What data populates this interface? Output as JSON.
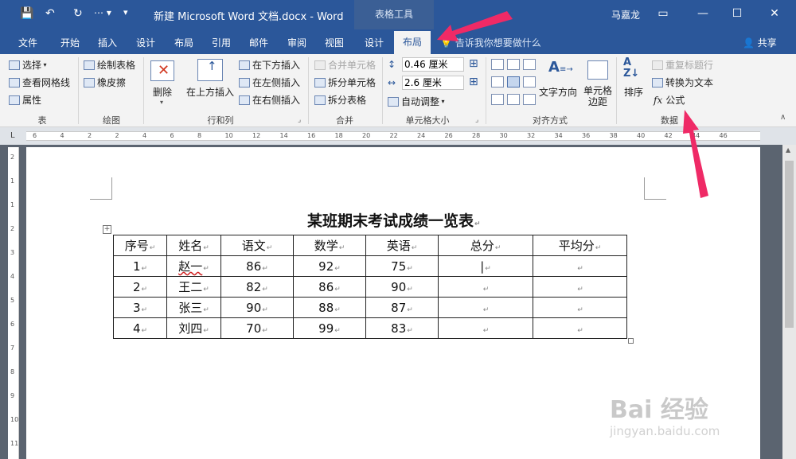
{
  "titlebar": {
    "title": "新建 Microsoft Word 文档.docx  -  Word",
    "context_title": "表格工具",
    "user": "马嘉龙",
    "qat": {
      "save": "💾",
      "undo": "↶",
      "redo": "↻"
    }
  },
  "tabs": [
    "文件",
    "开始",
    "插入",
    "设计",
    "布局",
    "引用",
    "邮件",
    "审阅",
    "视图",
    "设计"
  ],
  "active_tab": "布局",
  "tell_me": "告诉我你想要做什么",
  "share": "共享",
  "ribbon": {
    "table": {
      "select": "选择",
      "gridlines": "查看网格线",
      "properties": "属性",
      "label": "表"
    },
    "draw": {
      "draw_table": "绘制表格",
      "eraser": "橡皮擦",
      "label": "绘图"
    },
    "rows_cols": {
      "delete": "删除",
      "insert_above": "在上方插入",
      "insert_below": "在下方插入",
      "insert_left": "在左侧插入",
      "insert_right": "在右侧插入",
      "label": "行和列"
    },
    "merge": {
      "merge_cells": "合并单元格",
      "split_cells": "拆分单元格",
      "split_table": "拆分表格",
      "label": "合并"
    },
    "cell_size": {
      "height": "0.46 厘米",
      "width": "2.6 厘米",
      "autofit": "自动调整",
      "label": "单元格大小"
    },
    "alignment": {
      "text_direction": "文字方向",
      "cell_margins": "单元格边距",
      "label": "对齐方式"
    },
    "data": {
      "sort": "排序",
      "repeat_header": "重复标题行",
      "convert_text": "转换为文本",
      "formula": "公式",
      "label": "数据"
    }
  },
  "ruler_ticks": [
    "6",
    "4",
    "2",
    "2",
    "4",
    "6",
    "8",
    "10",
    "12",
    "14",
    "16",
    "18",
    "20",
    "22",
    "24",
    "26",
    "28",
    "30",
    "32",
    "34",
    "36",
    "38",
    "40",
    "42",
    "44",
    "46"
  ],
  "document": {
    "heading": "某班期末考试成绩一览表",
    "headers": [
      "序号",
      "姓名",
      "语文",
      "数学",
      "英语",
      "总分",
      "平均分"
    ],
    "rows": [
      [
        "1",
        "赵一",
        "86",
        "92",
        "75",
        "",
        ""
      ],
      [
        "2",
        "王二",
        "82",
        "86",
        "90",
        "",
        ""
      ],
      [
        "3",
        "张三",
        "90",
        "88",
        "87",
        "",
        ""
      ],
      [
        "4",
        "刘四",
        "70",
        "99",
        "83",
        "",
        ""
      ]
    ]
  },
  "watermark": {
    "main": "Bai 经验",
    "sub": "jingyan.baidu.com"
  },
  "colors": {
    "accent": "#2b579a",
    "arrow": "#ef2a66"
  }
}
